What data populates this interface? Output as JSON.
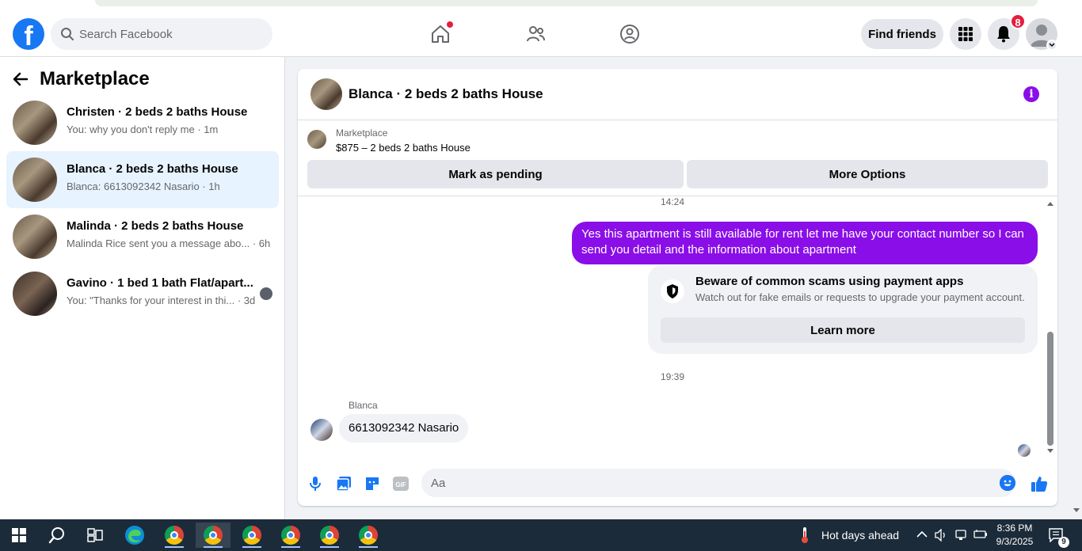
{
  "header": {
    "search_placeholder": "Search Facebook",
    "find_friends_label": "Find friends",
    "notifications_count": "8",
    "logo_letter": "f"
  },
  "sidebar": {
    "title": "Marketplace",
    "conversations": [
      {
        "name": "Christen · 2 beds 2 baths House",
        "preview": "You: why you don't reply me · 1m"
      },
      {
        "name": "Blanca · 2 beds 2 baths House",
        "preview": "Blanca: 6613092342 Nasario · 1h"
      },
      {
        "name": "Malinda · 2 beds 2 baths House",
        "preview": "Malinda Rice sent you a message abo... · 6h"
      },
      {
        "name": "Gavino · 1 bed 1 bath Flat/apart...",
        "preview": "You: \"Thanks for your interest in thi... · 3d"
      }
    ]
  },
  "chat": {
    "title": "Blanca · 2 beds 2 baths House",
    "listing_category": "Marketplace",
    "listing_price": "$875 – 2 beds 2 baths House",
    "mark_pending_label": "Mark as pending",
    "more_options_label": "More Options",
    "messages": {
      "time_1": "14:24",
      "outgoing_1": "Yes this apartment is still available for rent let me have your contact number so I can send you detail and the information about apartment",
      "scam_title": "Beware of common scams using payment apps",
      "scam_text": "Watch out for fake emails or requests to upgrade your payment account.",
      "learn_more_label": "Learn more",
      "time_2": "19:39",
      "sender_name": "Blanca",
      "incoming_1": "6613092342 Nasario"
    },
    "composer_placeholder": "Aa"
  },
  "taskbar": {
    "weather_text": "Hot days ahead",
    "time": "8:36 PM",
    "date": "9/3/2025",
    "notification_count": "9"
  },
  "colors": {
    "brand_blue": "#1877f2",
    "messenger_purple": "#8a0ee8",
    "badge_red": "#e41e3f",
    "active_row": "#e7f3ff"
  }
}
